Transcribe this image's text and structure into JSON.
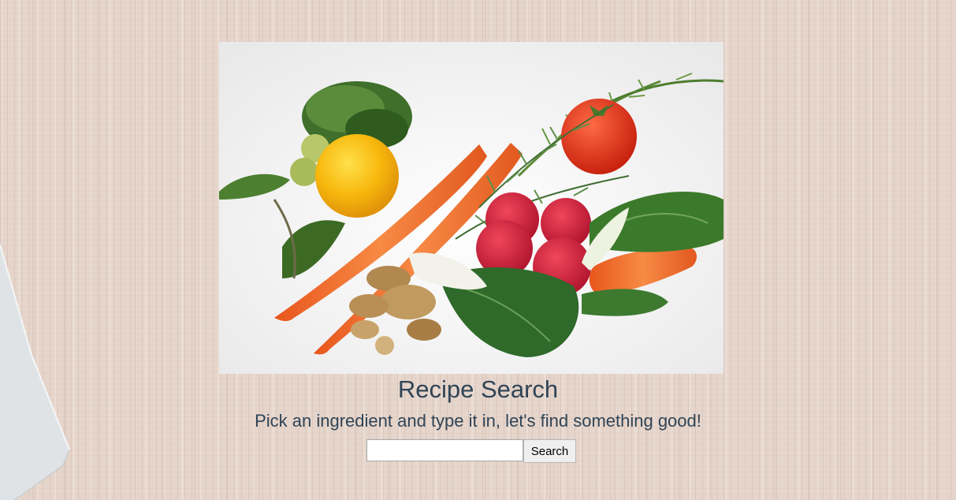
{
  "page": {
    "title": "Recipe Search",
    "subtitle": "Pick an ingredient and type it in, let's find something good!"
  },
  "search": {
    "value": "",
    "placeholder": "",
    "button_label": "Search"
  },
  "hero_image": {
    "alt": "vegetables"
  },
  "colors": {
    "heading": "#2f4456",
    "background": "#e6d5cb"
  }
}
